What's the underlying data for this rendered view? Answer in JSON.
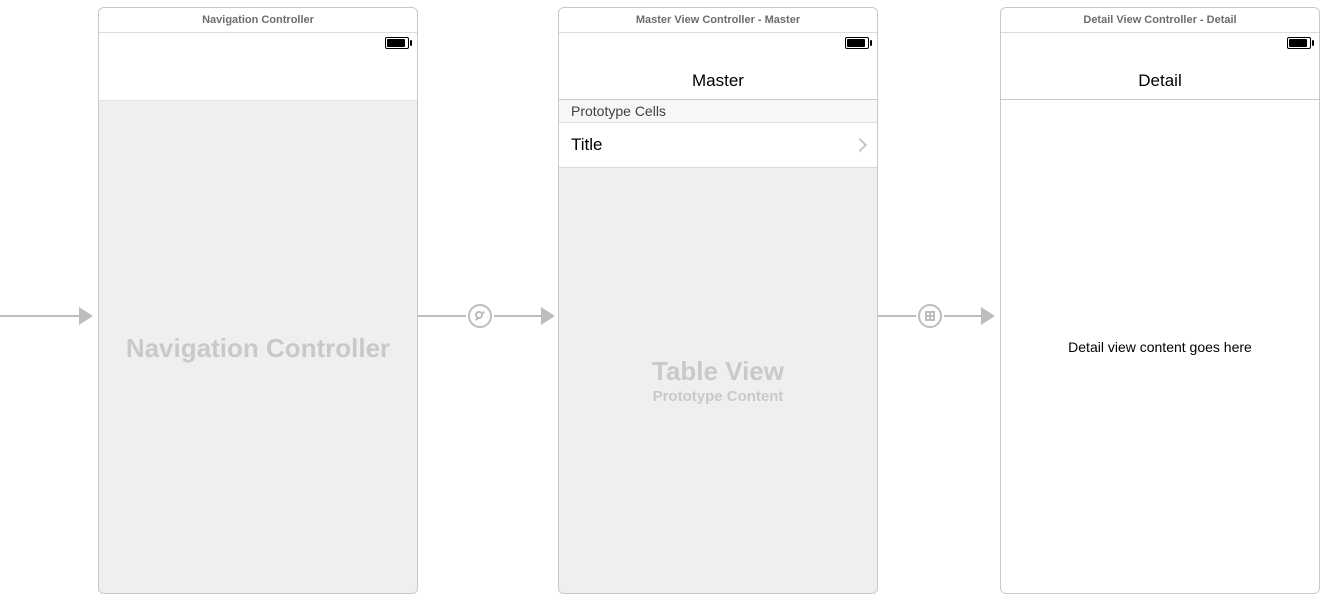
{
  "scenes": {
    "nav": {
      "header": "Navigation Controller",
      "placeholder": "Navigation Controller"
    },
    "master": {
      "header": "Master View Controller - Master",
      "nav_title": "Master",
      "prototype_section": "Prototype Cells",
      "cell_title": "Title",
      "tableview_title": "Table View",
      "tableview_sub": "Prototype Content"
    },
    "detail": {
      "header": "Detail View Controller - Detail",
      "nav_title": "Detail",
      "body": "Detail view content goes here"
    }
  }
}
